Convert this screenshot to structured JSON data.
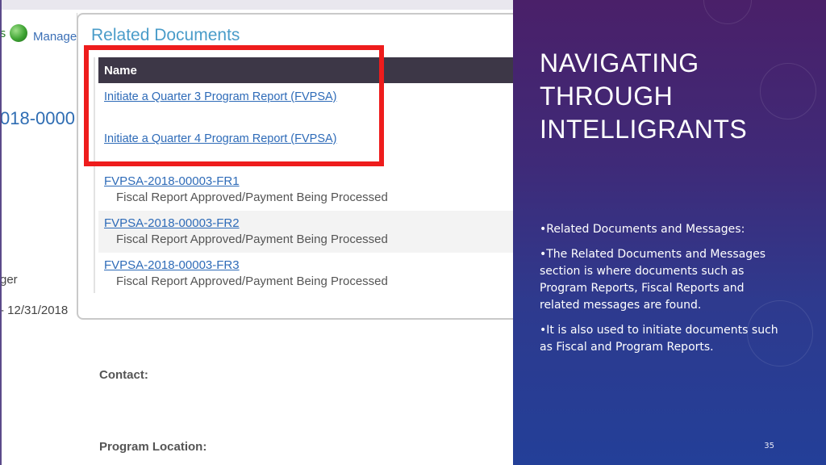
{
  "screenshot": {
    "nav": {
      "back_arrow": "s",
      "manage_label": "Manage",
      "manage_icon": "green-globe-icon"
    },
    "doc_number_fragment": "018-0000",
    "side_text_1": "ger",
    "side_text_2": "- 12/31/2018",
    "panel": {
      "title": "Related Documents",
      "column_header": "Name",
      "initiate_links": [
        "Initiate a Quarter 3 Program Report (FVPSA)",
        "Initiate a Quarter 4 Program Report (FVPSA)"
      ],
      "documents": [
        {
          "id": "FVPSA-2018-00003-FR1",
          "status": "Fiscal Report Approved/Payment Being Processed"
        },
        {
          "id": "FVPSA-2018-00003-FR2",
          "status": "Fiscal Report Approved/Payment Being Processed"
        },
        {
          "id": "FVPSA-2018-00003-FR3",
          "status": "Fiscal Report Approved/Payment Being Processed"
        }
      ]
    },
    "contact_label": "Contact:",
    "program_location_label": "Program Location:",
    "highlight_color": "#ee1c1c"
  },
  "slide": {
    "title_lines": [
      "NAVIGATING",
      "THROUGH",
      "INTELLIGRANTS"
    ],
    "bullets": [
      "•Related Documents and Messages:",
      "•The Related Documents and Messages section is where documents such as Program Reports, Fiscal Reports and related messages are found.",
      "•It is also used to initiate documents such as Fiscal and Program Reports."
    ],
    "page_number": "35",
    "background_top": "#4a2069",
    "background_bottom": "#233f98"
  }
}
